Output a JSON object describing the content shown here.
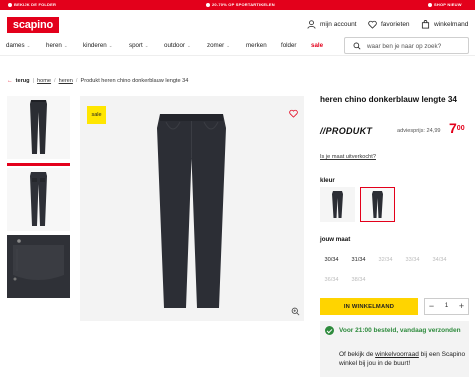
{
  "promo": [
    {
      "label": "BEKIJK DE FOLDER"
    },
    {
      "label": "20-70% OP SPORTARTIKELEN"
    },
    {
      "label": "SHOP NIEUW"
    }
  ],
  "header": {
    "logo": "scapino",
    "account": "mijn account",
    "favorites": "favorieten",
    "cart": "winkelmand"
  },
  "nav": {
    "items": [
      "dames",
      "heren",
      "kinderen",
      "sport",
      "outdoor",
      "zomer",
      "merken",
      "folder",
      "sale"
    ],
    "search_placeholder": "waar ben je naar op zoek?"
  },
  "breadcrumb": {
    "back": "terug",
    "crumbs": [
      "home",
      "heren"
    ],
    "current": "Produkt heren chino donkerblauw lengte 34"
  },
  "product": {
    "sale_badge": "sale",
    "title": "heren chino donkerblauw lengte 34",
    "brand": "//PRODUKT",
    "advice_label": "adviesprijs:",
    "advice_price": "24,99",
    "price_main": "7",
    "price_cents": "00",
    "sold_out_link": "Is je maat uitverkocht?",
    "color_label": "kleur",
    "size_label": "jouw maat",
    "sizes": [
      {
        "label": "30/34",
        "available": true
      },
      {
        "label": "31/34",
        "available": true
      },
      {
        "label": "32/34",
        "available": false
      },
      {
        "label": "33/34",
        "available": false
      },
      {
        "label": "34/34",
        "available": false
      },
      {
        "label": "36/34",
        "available": false
      },
      {
        "label": "38/34",
        "available": false
      }
    ],
    "add_to_cart": "IN WINKELMAND",
    "quantity": "1",
    "minus": "−",
    "plus": "+"
  },
  "delivery": {
    "heading": "Voor 21:00 besteld, vandaag verzonden",
    "body_pre": "Of bekijk de ",
    "body_link": "winkelvoorraad",
    "body_post": " bij een Scapino winkel bij jou in de buurt!"
  },
  "colors": {
    "brand_red": "#e3001b",
    "cta_yellow": "#ffd400",
    "sale_yellow": "#ffe600",
    "success_green": "#2e8b3d"
  },
  "icons": [
    "user-icon",
    "heart-icon",
    "cart-icon",
    "search-icon",
    "arrow-left-icon",
    "zoom-icon",
    "check-icon"
  ]
}
